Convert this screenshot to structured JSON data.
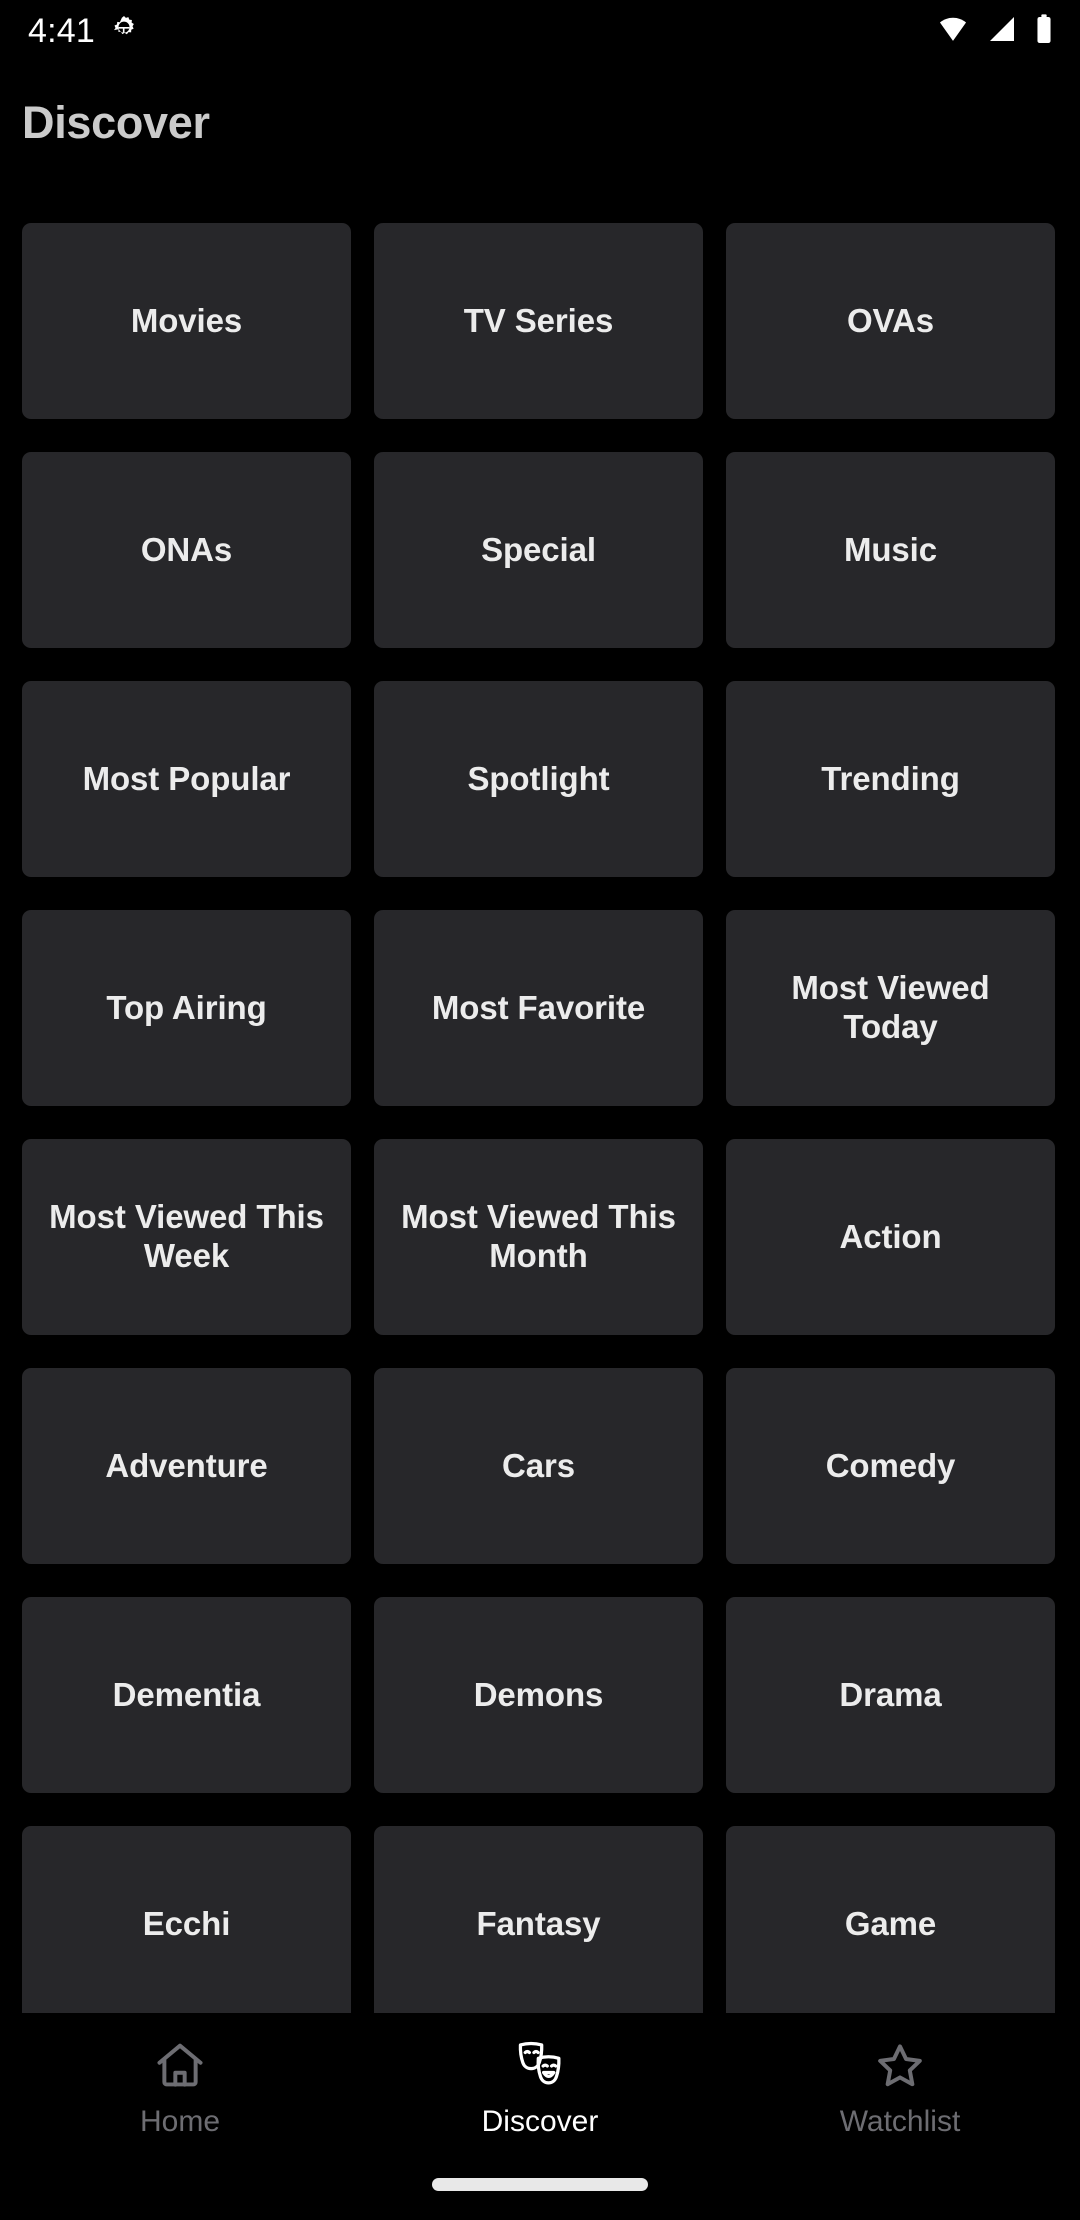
{
  "status_bar": {
    "time": "4:41",
    "icons": {
      "notification": "gear-icon",
      "wifi": "wifi-icon",
      "signal": "cell-signal-icon",
      "battery": "battery-full-icon"
    }
  },
  "header": {
    "title": "Discover",
    "title_color": "#cbcbcb"
  },
  "theme": {
    "background": "#000000",
    "tile_background": "#27272a",
    "tile_text": "#ececec",
    "nav_active": "#ffffff",
    "nav_inactive": "#6d6d72"
  },
  "grid": {
    "columns": 3,
    "tiles": [
      {
        "label": "Movies"
      },
      {
        "label": "TV Series"
      },
      {
        "label": "OVAs"
      },
      {
        "label": "ONAs"
      },
      {
        "label": "Special"
      },
      {
        "label": "Music"
      },
      {
        "label": "Most Popular"
      },
      {
        "label": "Spotlight"
      },
      {
        "label": "Trending"
      },
      {
        "label": "Top Airing"
      },
      {
        "label": "Most Favorite"
      },
      {
        "label": "Most Viewed Today"
      },
      {
        "label": "Most Viewed This Week"
      },
      {
        "label": "Most Viewed This Month"
      },
      {
        "label": "Action"
      },
      {
        "label": "Adventure"
      },
      {
        "label": "Cars"
      },
      {
        "label": "Comedy"
      },
      {
        "label": "Dementia"
      },
      {
        "label": "Demons"
      },
      {
        "label": "Drama"
      },
      {
        "label": "Ecchi"
      },
      {
        "label": "Fantasy"
      },
      {
        "label": "Game"
      }
    ]
  },
  "bottom_nav": {
    "items": [
      {
        "label": "Home",
        "icon": "house-icon",
        "active": false
      },
      {
        "label": "Discover",
        "icon": "theater-masks-icon",
        "active": true
      },
      {
        "label": "Watchlist",
        "icon": "star-icon",
        "active": false
      }
    ]
  }
}
